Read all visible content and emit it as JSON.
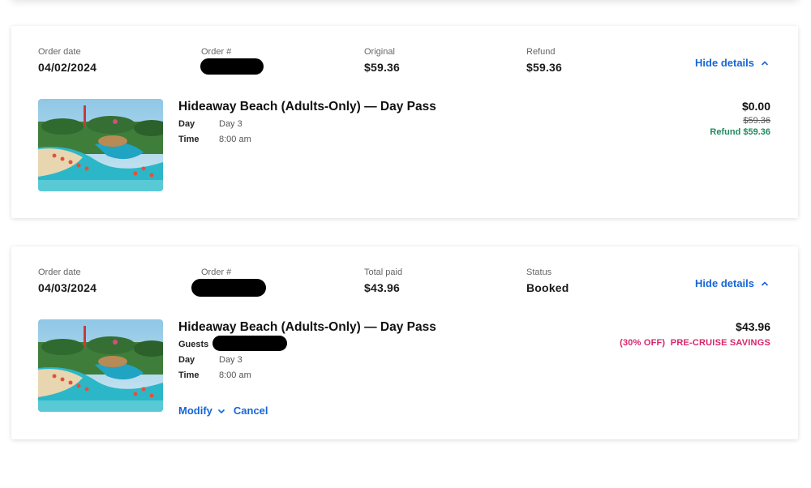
{
  "orders": [
    {
      "date_label": "Order date",
      "date": "04/02/2024",
      "order_label": "Order #",
      "col3_label": "Original",
      "col3_value": "$59.36",
      "col4_label": "Refund",
      "col4_value": "$59.36",
      "toggle_label": "Hide details",
      "item": {
        "title": "Hideaway Beach (Adults-Only) — Day Pass",
        "day_label": "Day",
        "day_value": "Day 3",
        "time_label": "Time",
        "time_value": "8:00 am",
        "price": "$0.00",
        "original_price": "$59.36",
        "refund_text": "Refund $59.36"
      }
    },
    {
      "date_label": "Order date",
      "date": "04/03/2024",
      "order_label": "Order #",
      "col3_label": "Total paid",
      "col3_value": "$43.96",
      "col4_label": "Status",
      "col4_value": "Booked",
      "toggle_label": "Hide details",
      "item": {
        "title": "Hideaway Beach (Adults-Only) — Day Pass",
        "guests_label": "Guests",
        "day_label": "Day",
        "day_value": "Day 3",
        "time_label": "Time",
        "time_value": "8:00 am",
        "price": "$43.96",
        "savings_text": "(30% OFF)  PRE-CRUISE SAVINGS"
      },
      "actions": {
        "modify": "Modify",
        "cancel": "Cancel"
      }
    }
  ],
  "colors": {
    "link": "#1765d6",
    "refund": "#1f8a5f",
    "savings": "#d8246b"
  },
  "icons": [
    "chevron-up-icon",
    "chevron-down-icon"
  ]
}
